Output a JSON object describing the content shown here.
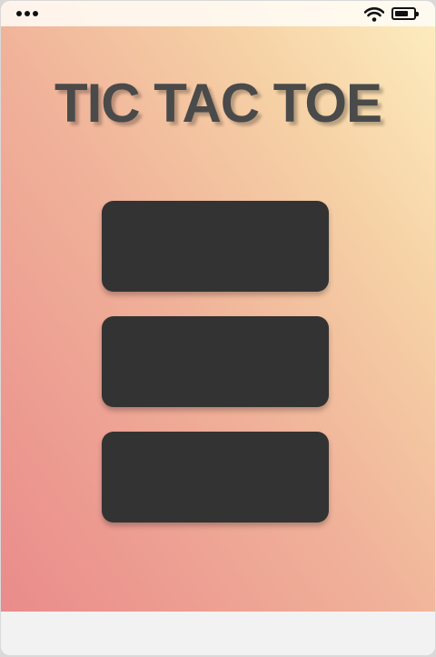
{
  "app": {
    "title": "TIC TAC TOE"
  },
  "status_bar": {
    "menu_icon": "more-dots-icon",
    "wifi_icon": "wifi-icon",
    "battery_icon": "battery-icon",
    "battery_level": 0.75
  },
  "menu": {
    "buttons": [
      {
        "label": ""
      },
      {
        "label": ""
      },
      {
        "label": ""
      }
    ]
  },
  "colors": {
    "button": "#333333",
    "title": "#4a4a4a",
    "gradient_start": "#ea8b8b",
    "gradient_end": "#fdeec0",
    "bottom_bar": "#f2f2f2"
  }
}
